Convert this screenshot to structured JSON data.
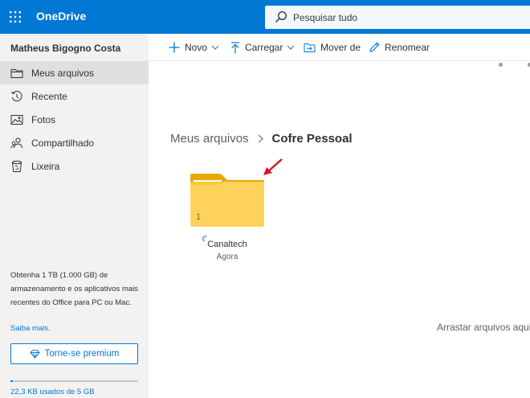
{
  "app": {
    "title": "OneDrive",
    "brand_color": "#0078d4"
  },
  "search": {
    "placeholder": "Pesquisar tudo",
    "icon": "search-icon"
  },
  "sidebar": {
    "user_name": "Matheus Bigogno Costa",
    "items": [
      {
        "label": "Meus arquivos",
        "icon": "folder-icon",
        "active": true
      },
      {
        "label": "Recente",
        "icon": "history-icon",
        "active": false
      },
      {
        "label": "Fotos",
        "icon": "photo-icon",
        "active": false
      },
      {
        "label": "Compartilhado",
        "icon": "people-icon",
        "active": false
      },
      {
        "label": "Lixeira",
        "icon": "trash-icon",
        "active": false
      }
    ],
    "storage_promo": "Obtenha 1 TB (1.000 GB) de armazenamento e os aplicativos mais recentes do Office para PC ou Mac.",
    "learn_more": "Saiba mais.",
    "premium_button": "Torne-se premium",
    "quota_text": "22,3 KB usados de 5 GB",
    "quota_fraction": 0.02
  },
  "commandbar": {
    "new": "Novo",
    "upload": "Carregar",
    "move_to": "Mover de",
    "rename": "Renomear"
  },
  "breadcrumb": {
    "parent": "Meus arquivos",
    "current": "Cofre Pessoal"
  },
  "folder": {
    "name": "Canaltech",
    "modified": "Agora",
    "item_count": "1"
  },
  "drop_hint": "Arrastar arquivos aqui"
}
